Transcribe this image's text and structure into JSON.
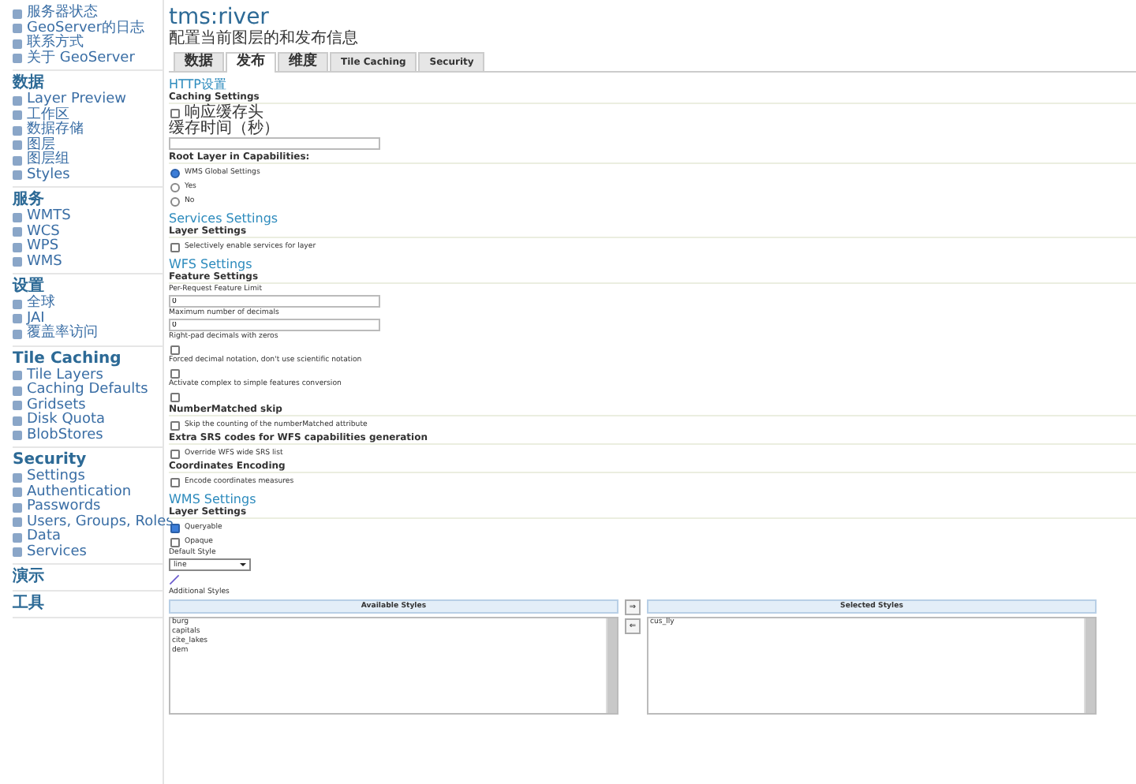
{
  "sidebar": {
    "sections": [
      {
        "items": [
          {
            "label": "服务器状态"
          },
          {
            "label": "GeoServer的日志"
          },
          {
            "label": "联系方式"
          },
          {
            "label": "关于 GeoServer"
          }
        ]
      },
      {
        "heading": "数据",
        "items": [
          {
            "label": "Layer Preview"
          },
          {
            "label": "工作区"
          },
          {
            "label": "数据存储"
          },
          {
            "label": "图层"
          },
          {
            "label": "图层组"
          },
          {
            "label": "Styles"
          }
        ]
      },
      {
        "heading": "服务",
        "items": [
          {
            "label": "WMTS"
          },
          {
            "label": "WCS"
          },
          {
            "label": "WPS"
          },
          {
            "label": "WMS"
          }
        ]
      },
      {
        "heading": "设置",
        "items": [
          {
            "label": "全球"
          },
          {
            "label": "JAI"
          },
          {
            "label": "覆盖率访问"
          }
        ]
      },
      {
        "heading": "Tile Caching",
        "items": [
          {
            "label": "Tile Layers"
          },
          {
            "label": "Caching Defaults"
          },
          {
            "label": "Gridsets"
          },
          {
            "label": "Disk Quota"
          },
          {
            "label": "BlobStores"
          }
        ]
      },
      {
        "heading": "Security",
        "items": [
          {
            "label": "Settings"
          },
          {
            "label": "Authentication"
          },
          {
            "label": "Passwords"
          },
          {
            "label": "Users, Groups, Roles"
          },
          {
            "label": "Data"
          },
          {
            "label": "Services"
          }
        ]
      },
      {
        "heading": "演示"
      },
      {
        "heading": "工具"
      }
    ]
  },
  "page": {
    "title": "tms:river",
    "subtitle": "配置当前图层的和发布信息"
  },
  "tabs": [
    {
      "label": "数据",
      "selected": false
    },
    {
      "label": "发布",
      "selected": true
    },
    {
      "label": "维度",
      "selected": false
    },
    {
      "label": "Tile Caching",
      "selected": false
    },
    {
      "label": "Security",
      "selected": false
    }
  ],
  "form": [
    {
      "kind": "heading",
      "text": "HTTP设置"
    },
    {
      "kind": "subheading",
      "text": "Caching Settings"
    },
    {
      "kind": "checkbox",
      "label": "响应缓存头",
      "checked": false
    },
    {
      "kind": "field",
      "label": "缓存时间（秒）"
    },
    {
      "kind": "subheading",
      "text": "Root Layer in Capabilities:"
    },
    {
      "kind": "radio",
      "label": "WMS Global Settings",
      "selected": true
    },
    {
      "kind": "radio",
      "label": "Yes",
      "selected": false
    },
    {
      "kind": "radio",
      "label": "No",
      "selected": false
    },
    {
      "kind": "heading",
      "text": "Services Settings"
    },
    {
      "kind": "subheading",
      "text": "Layer Settings"
    },
    {
      "kind": "checkbox",
      "label": "Selectively enable services for layer",
      "checked": false
    },
    {
      "kind": "heading",
      "text": "WFS Settings"
    },
    {
      "kind": "subheading",
      "text": "Feature Settings"
    },
    {
      "kind": "field",
      "label": "Per-Request Feature Limit",
      "value": "0"
    },
    {
      "kind": "field",
      "label": "Maximum number of decimals",
      "value": "0"
    },
    {
      "kind": "checkbox_below",
      "label": "Right-pad decimals with zeros",
      "checked": false
    },
    {
      "kind": "checkbox_below",
      "label": "Forced decimal notation, don't use scientific notation",
      "checked": false
    },
    {
      "kind": "checkbox_below",
      "label": "Activate complex to simple features conversion",
      "checked": false
    },
    {
      "kind": "subheading",
      "text": "NumberMatched skip"
    },
    {
      "kind": "checkbox",
      "label": "Skip the counting of the numberMatched attribute",
      "checked": false
    },
    {
      "kind": "subheading",
      "text": "Extra SRS codes for WFS capabilities generation"
    },
    {
      "kind": "checkbox",
      "label": "Override WFS wide SRS list",
      "checked": false
    },
    {
      "kind": "subheading",
      "text": "Coordinates Encoding"
    },
    {
      "kind": "checkbox",
      "label": "Encode coordinates measures",
      "checked": false
    },
    {
      "kind": "heading",
      "text": "WMS Settings"
    },
    {
      "kind": "subheading",
      "text": "Layer Settings"
    },
    {
      "kind": "checkbox",
      "label": "Queryable",
      "checked": true
    },
    {
      "kind": "checkbox",
      "label": "Opaque",
      "checked": false
    },
    {
      "kind": "select",
      "label": "Default Style",
      "value": "line"
    },
    {
      "kind": "label",
      "text": "Additional Styles"
    }
  ],
  "palette": {
    "available": {
      "header": "Available Styles",
      "items": [
        "burg",
        "capitals",
        "cite_lakes",
        "dem"
      ]
    },
    "buttons": [
      "⇒",
      "⇐"
    ],
    "selected": {
      "header": "Selected Styles",
      "items": [
        "cus_lly"
      ]
    }
  }
}
